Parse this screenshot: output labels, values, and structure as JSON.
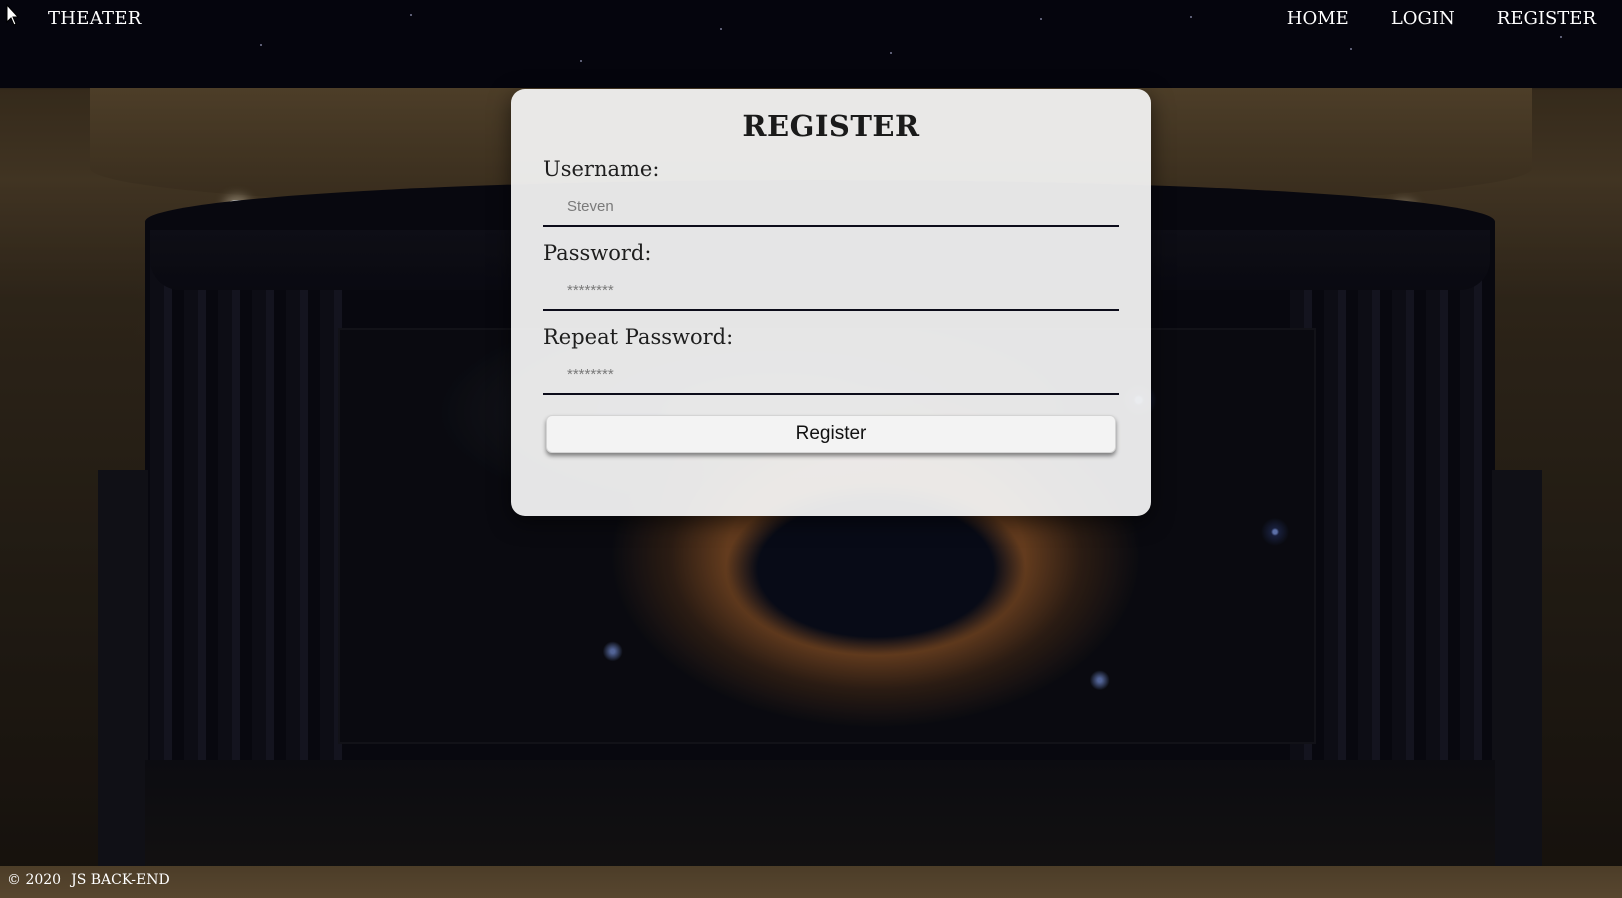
{
  "nav": {
    "brand": "THEATER",
    "links": [
      "HOME",
      "LOGIN",
      "REGISTER"
    ]
  },
  "form": {
    "title": "REGISTER",
    "username": {
      "label": "Username:",
      "placeholder": "Steven"
    },
    "password": {
      "label": "Password:",
      "placeholder": "********"
    },
    "repeat_password": {
      "label": "Repeat Password:",
      "placeholder": "********"
    },
    "submit_label": "Register"
  },
  "footer": {
    "copyright": "© 2020",
    "text": "JS BACK-END"
  },
  "colors": {
    "card_background": "#f3f3f3",
    "input_underline": "#0c0c1a",
    "nav_text": "#ffffff"
  },
  "icons": {
    "cursor": "mouse-pointer-icon"
  }
}
